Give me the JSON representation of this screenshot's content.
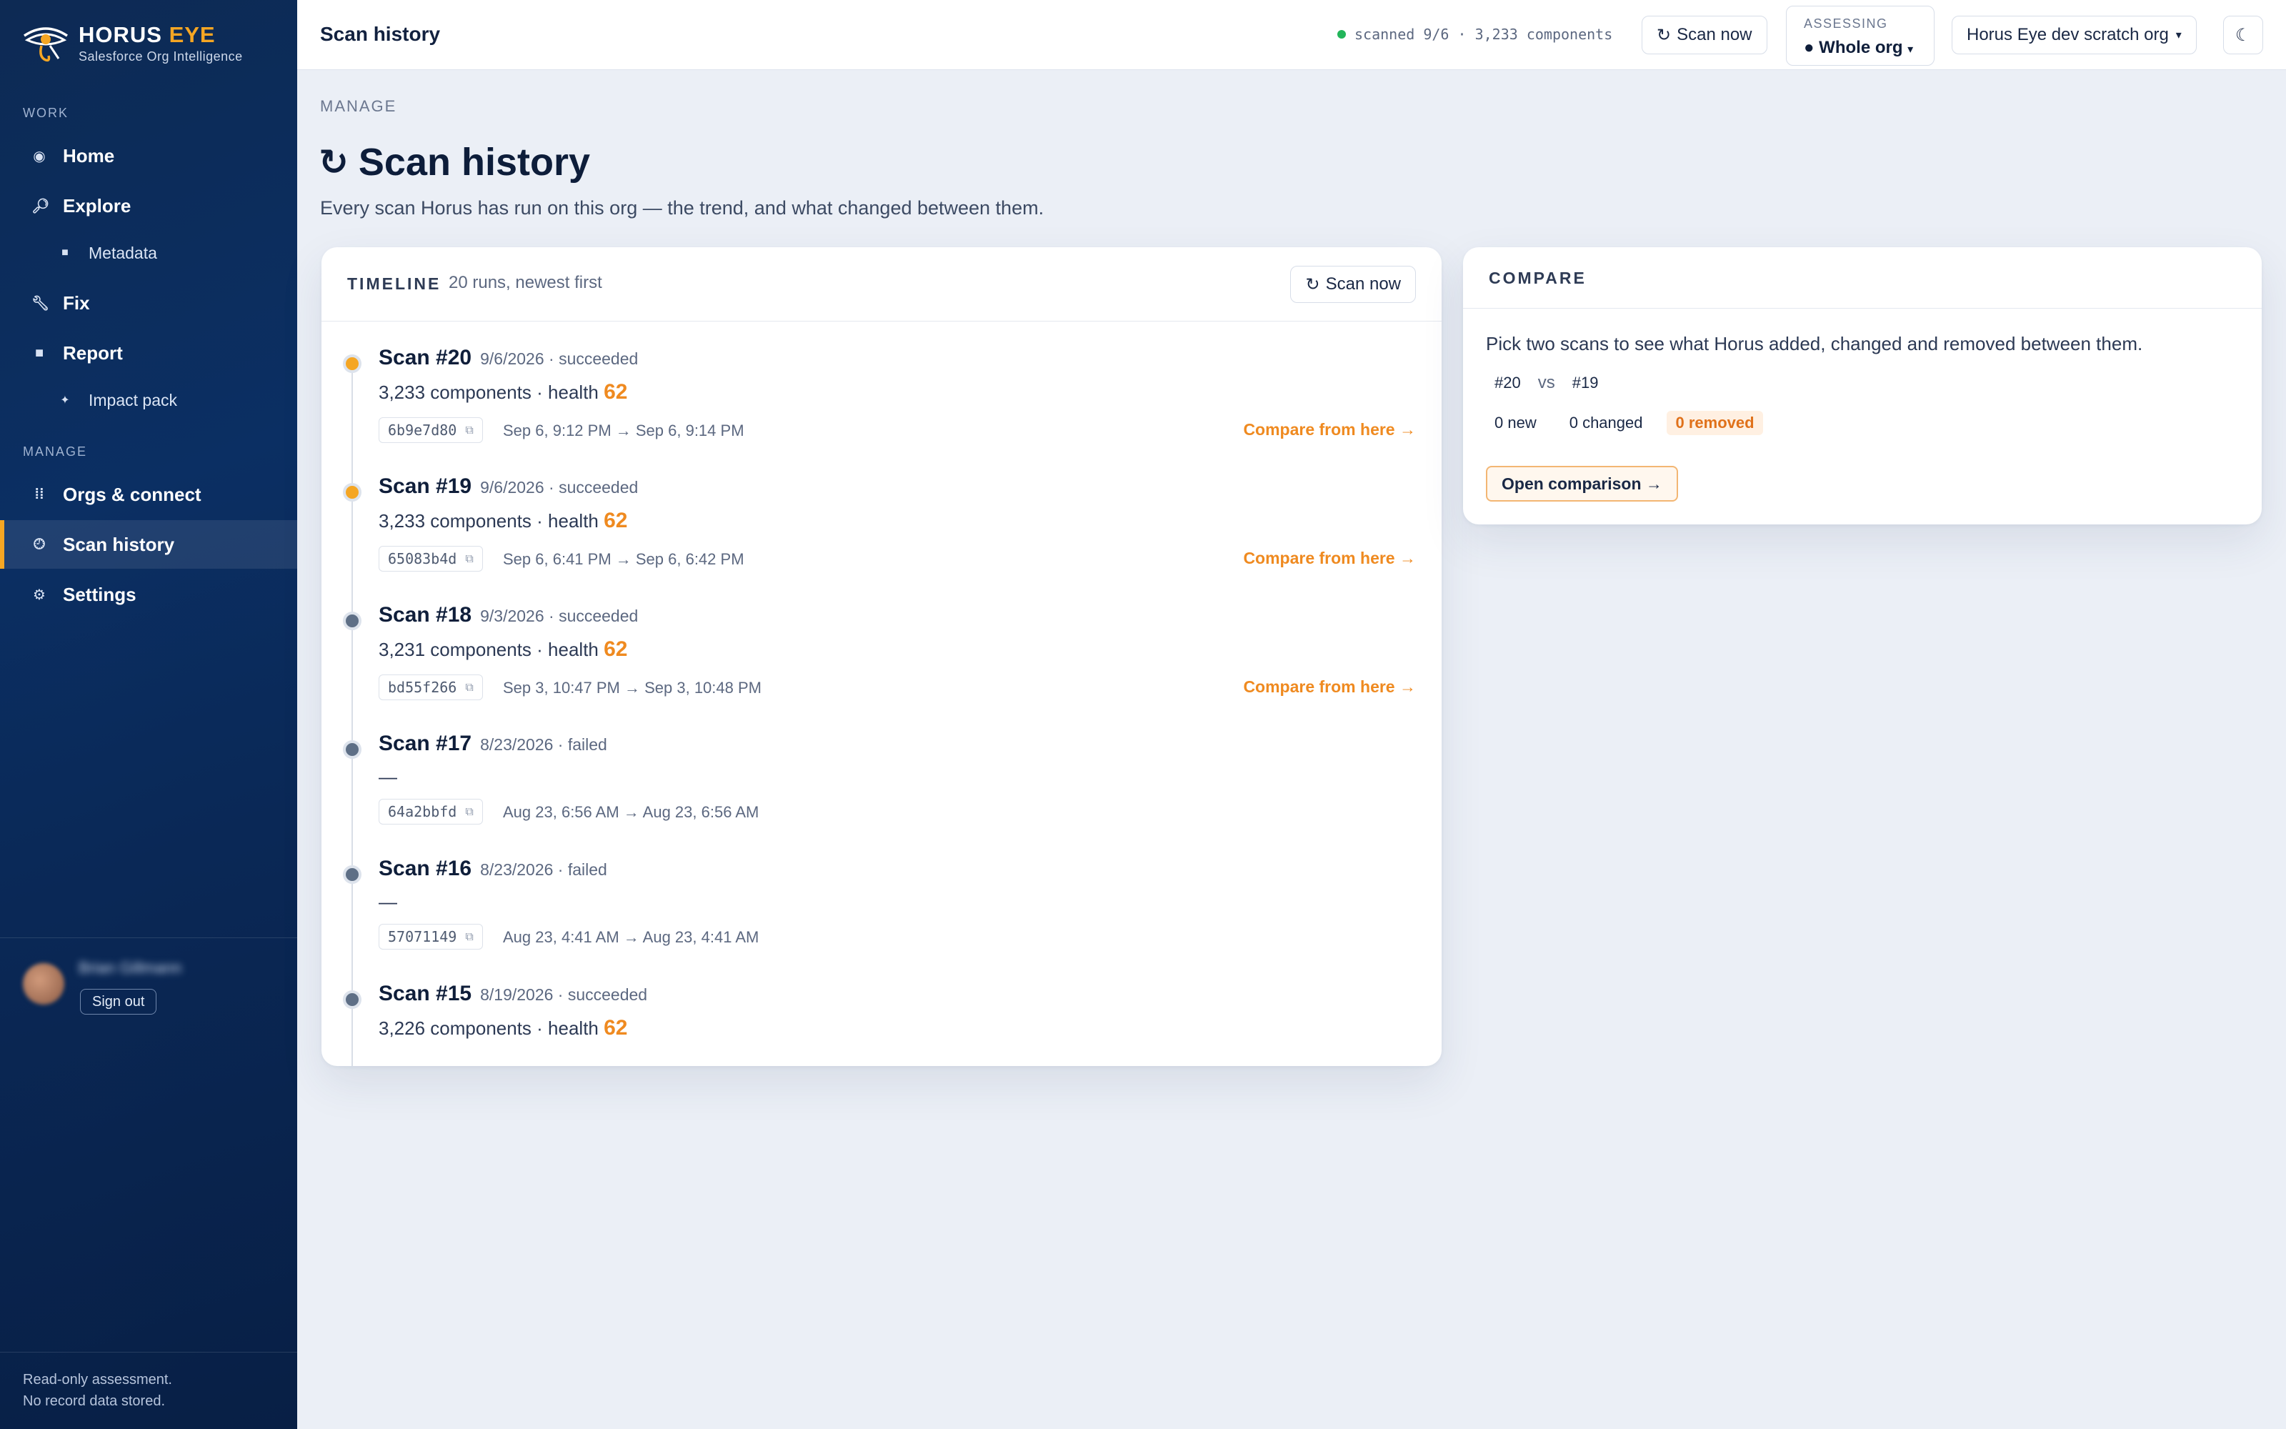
{
  "brand": {
    "name_main": "HORUS",
    "name_accent": "EYE",
    "tagline": "Salesforce Org Intelligence"
  },
  "sidebar": {
    "section_work": "WORK",
    "section_manage": "MANAGE",
    "items": [
      {
        "label": "Home",
        "icon": "home-icon"
      },
      {
        "label": "Explore",
        "icon": "search-icon"
      },
      {
        "label": "Metadata",
        "icon": "square-icon"
      },
      {
        "label": "Fix",
        "icon": "wrench-icon"
      },
      {
        "label": "Report",
        "icon": "square-icon"
      },
      {
        "label": "Impact pack",
        "icon": "sparkle-icon"
      },
      {
        "label": "Orgs & connect",
        "icon": "grid-icon"
      },
      {
        "label": "Scan history",
        "icon": "clock-icon"
      },
      {
        "label": "Settings",
        "icon": "gear-icon"
      }
    ],
    "user": {
      "name": "Brian Gillmann",
      "signout_label": "Sign out"
    },
    "footer_line1": "Read-only assessment.",
    "footer_line2": "No record data stored."
  },
  "topbar": {
    "title": "Scan history",
    "status_text": "scanned 9/6 · 3,233 components",
    "status_color": "#22b55a",
    "scan_now_label": "Scan now",
    "assessing_label": "ASSESSING",
    "assessing_value": "Whole org",
    "org_label": "Horus Eye dev scratch org",
    "theme_icon": "moon-icon"
  },
  "page": {
    "eyebrow": "MANAGE",
    "title": "Scan history",
    "description": "Every scan Horus has run on this org — the trend, and what changed between them."
  },
  "timeline": {
    "title": "TIMELINE",
    "subtitle": "20 runs, newest first",
    "scan_now_label": "Scan now",
    "compare_label": "Compare from here →",
    "health_label": "health",
    "scans": [
      {
        "title": "Scan #20",
        "meta": "9/6/2026 · succeeded",
        "components": "3,233 components ·",
        "health": "62",
        "hash": "6b9e7d80",
        "times": "Sep 6, 9:12 PM → Sep 6, 9:14 PM",
        "status": "gold"
      },
      {
        "title": "Scan #19",
        "meta": "9/6/2026 · succeeded",
        "components": "3,233 components ·",
        "health": "62",
        "hash": "65083b4d",
        "times": "Sep 6, 6:41 PM → Sep 6, 6:42 PM",
        "status": "gold"
      },
      {
        "title": "Scan #18",
        "meta": "9/3/2026 · succeeded",
        "components": "3,231 components ·",
        "health": "62",
        "hash": "bd55f266",
        "times": "Sep 3, 10:47 PM → Sep 3, 10:48 PM",
        "status": "gray"
      },
      {
        "title": "Scan #17",
        "meta": "8/23/2026 · failed",
        "components": "—",
        "health": "",
        "hash": "64a2bbfd",
        "times": "Aug 23, 6:56 AM → Aug 23, 6:56 AM",
        "status": "gray"
      },
      {
        "title": "Scan #16",
        "meta": "8/23/2026 · failed",
        "components": "—",
        "health": "",
        "hash": "57071149",
        "times": "Aug 23, 4:41 AM → Aug 23, 4:41 AM",
        "status": "gray"
      },
      {
        "title": "Scan #15",
        "meta": "8/19/2026 · succeeded",
        "components": "3,226 components ·",
        "health": "62",
        "hash": "",
        "times": "",
        "status": "gray"
      }
    ]
  },
  "compare": {
    "title": "COMPARE",
    "description": "Pick two scans to see what Horus added, changed and removed between them.",
    "scan_a": "#20",
    "vs_label": "vs",
    "scan_b": "#19",
    "new_label": "0 new",
    "changed_label": "0 changed",
    "removed_label": "0 removed",
    "open_label": "Open comparison →"
  },
  "colors": {
    "accent": "#f5a623",
    "health": "#ef8a20",
    "sidebar": "#0b2f63"
  }
}
